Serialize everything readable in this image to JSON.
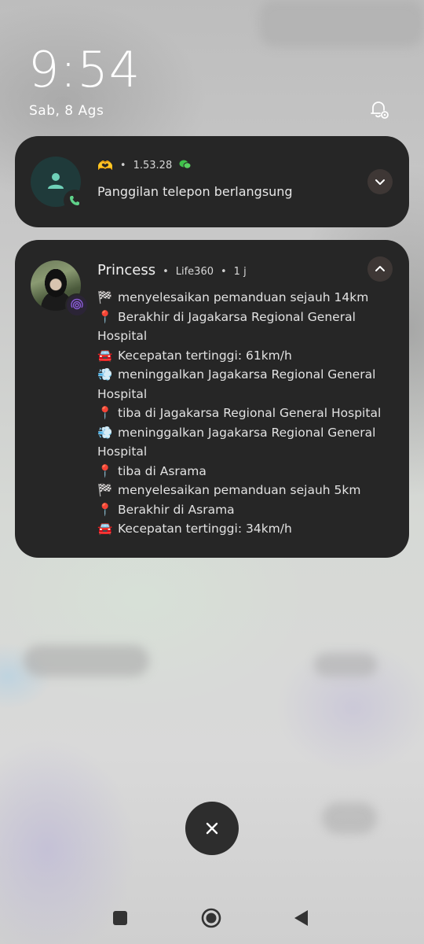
{
  "lockscreen": {
    "time": "9:54",
    "date": "Sab, 8 Ags"
  },
  "call_notification": {
    "app_emoji": "🫶",
    "separator": "•",
    "version": "1.53.28",
    "title": "Panggilan telepon berlangsung",
    "icons": [
      "contact-avatar-icon",
      "phone-icon",
      "wechat-icon",
      "chevron-down-icon"
    ]
  },
  "life360_notification": {
    "sender": "Princess",
    "separator": "•",
    "app": "Life360",
    "time": "1 j",
    "lines": [
      {
        "emoji": "🏁",
        "text": "menyelesaikan pemanduan sejauh 14km"
      },
      {
        "emoji": "📍",
        "text": "Berakhir di Jagakarsa Regional General Hospital"
      },
      {
        "emoji": "🚘",
        "text": "Kecepatan tertinggi: 61km/h"
      },
      {
        "emoji": "💨",
        "text": "meninggalkan Jagakarsa Regional General Hospital"
      },
      {
        "emoji": "📍",
        "text": "tiba di Jagakarsa Regional General Hospital"
      },
      {
        "emoji": "💨",
        "text": "meninggalkan Jagakarsa Regional General Hospital"
      },
      {
        "emoji": "📍",
        "text": "tiba di Asrama"
      },
      {
        "emoji": "🏁",
        "text": "menyelesaikan pemanduan sejauh 5km"
      },
      {
        "emoji": "📍",
        "text": "Berakhir di Asrama"
      },
      {
        "emoji": "🚘",
        "text": "Kecepatan tertinggi: 34km/h"
      }
    ],
    "icons": [
      "profile-photo",
      "life360-badge-icon",
      "chevron-up-icon"
    ]
  },
  "controls": {
    "icons": [
      "bell-settings-icon",
      "close-icon",
      "recents-square-icon",
      "home-circle-icon",
      "back-triangle-icon"
    ]
  },
  "colors": {
    "card_bg": "#262626",
    "call_avatar_bg": "#1f3a3a",
    "call_accent": "#6fd0b8",
    "wechat_green": "#3fc24a",
    "life360_purple": "#8a5cd6"
  }
}
